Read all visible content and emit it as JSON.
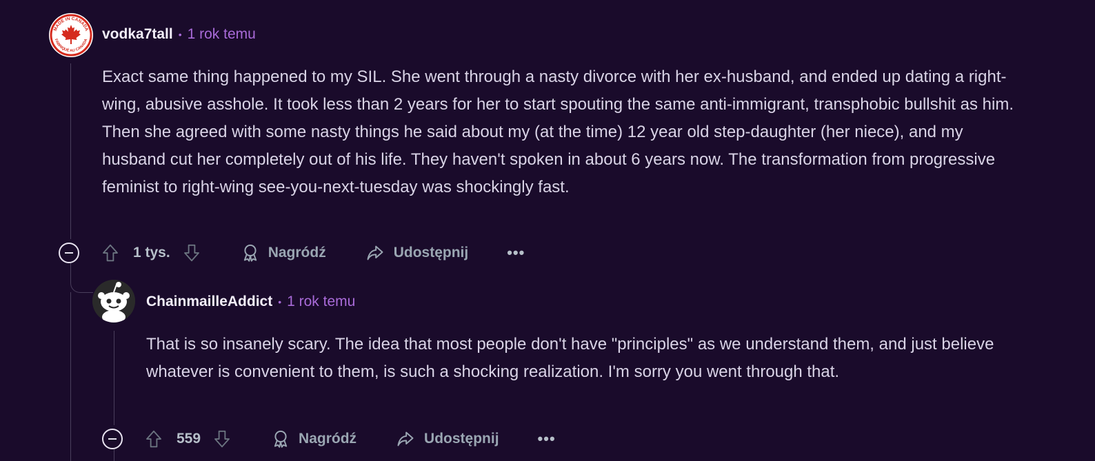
{
  "comments": [
    {
      "author": "vodka7tall",
      "time": "1 rok temu",
      "avatar_icon": "canada-flag-badge-icon",
      "avatar_text_top": "MADE IN CANADA",
      "avatar_text_bottom": "FABRIQUÉ AU CANADA",
      "body": "Exact same thing happened to my SIL. She went through a nasty divorce with her ex-husband, and ended up dating a right-wing, abusive asshole. It took less than 2 years for her to start spouting the same anti-immigrant, transphobic bullshit as him. Then she agreed with some nasty things he said about my (at the time) 12 year old step-daughter (her niece), and my husband cut her completely out of his life. They haven't spoken in about 6 years now. The transformation from progressive feminist to right-wing see-you-next-tuesday was shockingly fast.",
      "score": "1 tys.",
      "award_label": "Nagródź",
      "share_label": "Udostępnij",
      "more_label": "•••"
    },
    {
      "author": "ChainmailleAddict",
      "time": "1 rok temu",
      "avatar_icon": "snoo-avatar-icon",
      "body": "That is so insanely scary. The idea that most people don't have \"principles\" as we understand them, and just believe whatever is convenient to them, is such a shocking realization. I'm sorry you went through that.",
      "score": "559",
      "award_label": "Nagródź",
      "share_label": "Udostępnij",
      "more_label": "•••"
    }
  ],
  "meta_separator": "•",
  "colors": {
    "background": "#1a0b2b",
    "accent_time": "#a96bd9",
    "action_text": "#9aa6b2",
    "thread_line": "#4a3f5c"
  }
}
